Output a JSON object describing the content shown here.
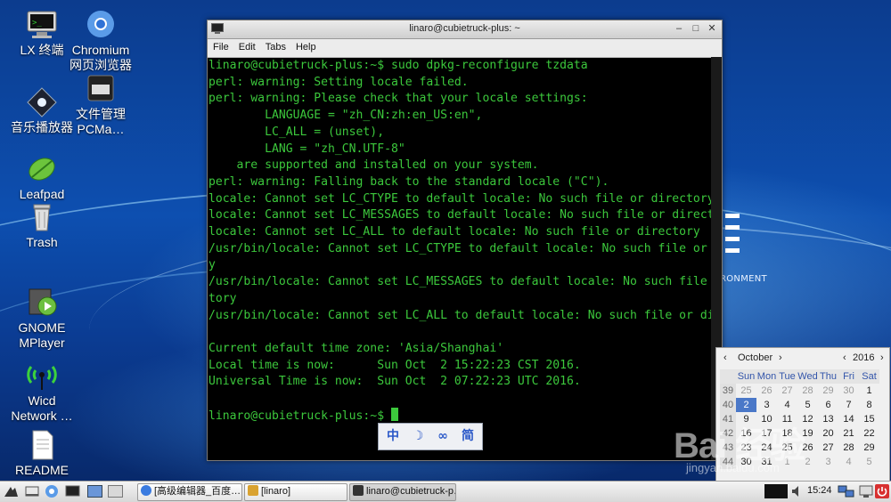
{
  "desktop_icons": [
    {
      "label": "LX 终端",
      "icon": "terminal-icon"
    },
    {
      "label": "Chromium",
      "label2": "网页浏览器",
      "icon": "chromium-icon"
    },
    {
      "label": "音乐播放器",
      "icon": "music-player-icon"
    },
    {
      "label": "文件管理",
      "label2": "PCMa…",
      "icon": "file-manager-icon"
    },
    {
      "label": "Leafpad",
      "icon": "leafpad-icon"
    },
    {
      "label": "Trash",
      "icon": "trash-icon"
    },
    {
      "label": "GNOME",
      "label2": "MPlayer",
      "icon": "mplayer-icon"
    },
    {
      "label": "Wicd",
      "label2": "Network …",
      "icon": "wicd-icon"
    },
    {
      "label": "README",
      "icon": "document-icon"
    }
  ],
  "wallpaper": {
    "brand_tail": "RONMENT"
  },
  "terminal": {
    "title": "linaro@cubietruck-plus: ~",
    "menu": [
      "File",
      "Edit",
      "Tabs",
      "Help"
    ],
    "lines": [
      "linaro@cubietruck-plus:~$ sudo dpkg-reconfigure tzdata",
      "perl: warning: Setting locale failed.",
      "perl: warning: Please check that your locale settings:",
      "        LANGUAGE = \"zh_CN:zh:en_US:en\",",
      "        LC_ALL = (unset),",
      "        LANG = \"zh_CN.UTF-8\"",
      "    are supported and installed on your system.",
      "perl: warning: Falling back to the standard locale (\"C\").",
      "locale: Cannot set LC_CTYPE to default locale: No such file or directory",
      "locale: Cannot set LC_MESSAGES to default locale: No such file or directory",
      "locale: Cannot set LC_ALL to default locale: No such file or directory",
      "/usr/bin/locale: Cannot set LC_CTYPE to default locale: No such file or director",
      "y",
      "/usr/bin/locale: Cannot set LC_MESSAGES to default locale: No such file or direc",
      "tory",
      "/usr/bin/locale: Cannot set LC_ALL to default locale: No such file or directory",
      "",
      "Current default time zone: 'Asia/Shanghai'",
      "Local time is now:      Sun Oct  2 15:22:23 CST 2016.",
      "Universal Time is now:  Sun Oct  2 07:22:23 UTC 2016.",
      ""
    ],
    "prompt": "linaro@cubietruck-plus:~$ "
  },
  "ime": [
    "中",
    "☽",
    "∞",
    "简"
  ],
  "calendar": {
    "month": "October",
    "year": "2016",
    "day_names": [
      "Sun",
      "Mon",
      "Tue",
      "Wed",
      "Thu",
      "Fri",
      "Sat"
    ],
    "weeks": [
      {
        "wk": "39",
        "days": [
          "25",
          "26",
          "27",
          "28",
          "29",
          "30",
          "1"
        ],
        "dim": [
          true,
          true,
          true,
          true,
          true,
          true,
          false
        ]
      },
      {
        "wk": "40",
        "days": [
          "2",
          "3",
          "4",
          "5",
          "6",
          "7",
          "8"
        ],
        "dim": [
          false,
          false,
          false,
          false,
          false,
          false,
          false
        ],
        "sel": 0
      },
      {
        "wk": "41",
        "days": [
          "9",
          "10",
          "11",
          "12",
          "13",
          "14",
          "15"
        ],
        "dim": [
          false,
          false,
          false,
          false,
          false,
          false,
          false
        ]
      },
      {
        "wk": "42",
        "days": [
          "16",
          "17",
          "18",
          "19",
          "20",
          "21",
          "22"
        ],
        "dim": [
          false,
          false,
          false,
          false,
          false,
          false,
          false
        ]
      },
      {
        "wk": "43",
        "days": [
          "23",
          "24",
          "25",
          "26",
          "27",
          "28",
          "29"
        ],
        "dim": [
          false,
          false,
          false,
          false,
          false,
          false,
          false
        ]
      },
      {
        "wk": "44",
        "days": [
          "30",
          "31",
          "1",
          "2",
          "3",
          "4",
          "5"
        ],
        "dim": [
          false,
          false,
          true,
          true,
          true,
          true,
          true
        ]
      }
    ]
  },
  "watermark": {
    "big": "Bai 经验",
    "small": "jingyan.baidu.com"
  },
  "taskbar": {
    "tasks": [
      {
        "label": "[高级编辑器_百度…",
        "icon": "chromium-icon",
        "color": "#3a7be0"
      },
      {
        "label": "[linaro]",
        "icon": "folder-icon",
        "color": "#d9a230"
      },
      {
        "label": "linaro@cubietruck-p…",
        "icon": "terminal-icon",
        "color": "#333333"
      }
    ],
    "clock": "15:24"
  }
}
